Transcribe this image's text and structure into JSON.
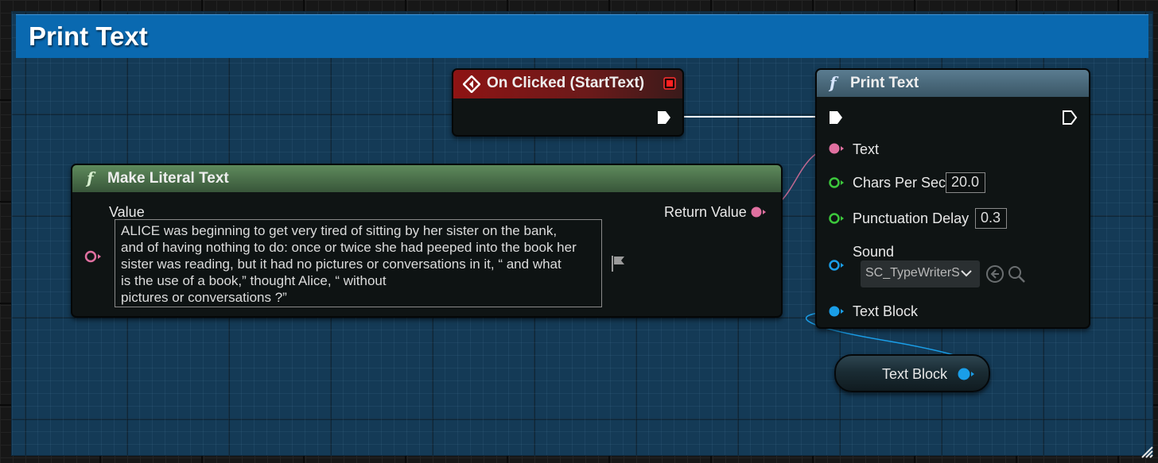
{
  "comment": {
    "title": "Print Text",
    "color": "#0a69b0"
  },
  "event_node": {
    "title": "On Clicked (StartText)",
    "header_color": "#8b1a1a"
  },
  "print_node": {
    "title": "Print Text",
    "pins": {
      "text": "Text",
      "chars_per_sec": "Chars Per Sec",
      "chars_per_sec_value": "20.0",
      "punctuation_delay": "Punctuation Delay",
      "punctuation_delay_value": "0.3",
      "sound": "Sound",
      "sound_value": "SC_TypeWriterS",
      "text_block": "Text Block"
    }
  },
  "literal_node": {
    "title": "Make Literal Text",
    "value_label": "Value",
    "return_label": "Return Value",
    "value_text": "ALICE was beginning to get very tired of sitting by her sister on the bank,\nand of having nothing to do: once or twice she had peeped into the book her\nsister was reading, but it had no pictures or conversations in it, “ and what\nis the use of a book,” thought Alice, “ without\npictures or conversations ?”"
  },
  "variable_node": {
    "label": "Text Block"
  },
  "colors": {
    "exec": "#ffffff",
    "text_pin": "#e070a0",
    "float_pin": "#3cc83c",
    "object_pin": "#1a9ee8",
    "literal_header": "#3f6b3f",
    "print_header": "#4a6c80"
  }
}
